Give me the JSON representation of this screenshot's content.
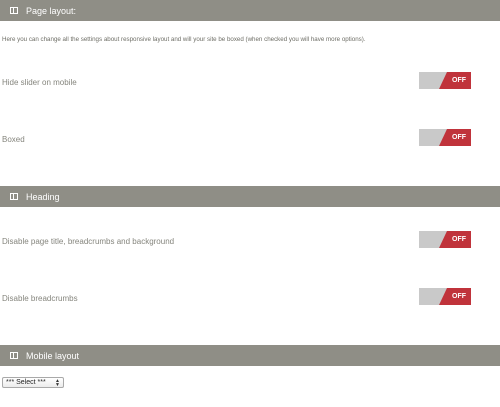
{
  "sections": [
    {
      "title": "Page layout:",
      "icon": "book-icon"
    },
    {
      "title": "Heading",
      "icon": "book-icon"
    },
    {
      "title": "Mobile layout",
      "icon": "book-icon"
    }
  ],
  "page_layout": {
    "description": "Here you can change all the settings about responsive layout and will your site be boxed (when checked you will have more options).",
    "rows": [
      {
        "label": "Hide slider on mobile",
        "toggle": "OFF"
      },
      {
        "label": "Boxed",
        "toggle": "OFF"
      }
    ]
  },
  "heading": {
    "rows": [
      {
        "label": "Disable page title, breadcrumbs and background",
        "toggle": "OFF"
      },
      {
        "label": "Disable breadcrumbs",
        "toggle": "OFF"
      }
    ]
  },
  "mobile_layout": {
    "select_value": "*** Select ***"
  },
  "colors": {
    "header_bg": "#8f8e86",
    "toggle_off": "#c0333b",
    "toggle_track": "#c9c9c9"
  }
}
